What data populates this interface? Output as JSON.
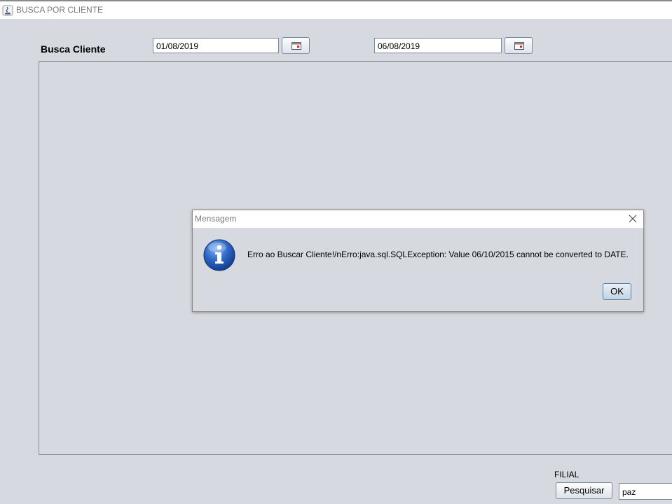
{
  "window": {
    "title": "BUSCA POR CLIENTE"
  },
  "form": {
    "heading": "Busca Cliente",
    "start_date": "01/08/2019",
    "end_date": "06/08/2019"
  },
  "footer": {
    "filial_label": "FILIAL",
    "search_label": "Pesquisar",
    "filial_value": "paz"
  },
  "dialog": {
    "title": "Mensagem",
    "message": "Erro ao Buscar Cliente!/nErro:java.sql.SQLException: Value 06/10/2015 cannot be converted to DATE.",
    "ok_label": "OK",
    "icon": "info-icon"
  },
  "colors": {
    "background": "#d6d9df",
    "info_blue": "#1f56b0"
  }
}
